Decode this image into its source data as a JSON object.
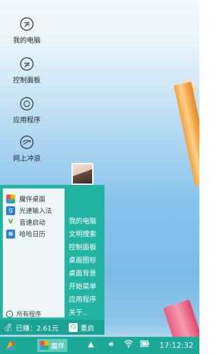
{
  "desktop": {
    "icons": [
      {
        "label": "我的电脑",
        "icon": "computer-icon"
      },
      {
        "label": "控制面板",
        "icon": "control-panel-icon"
      },
      {
        "label": "应用程序",
        "icon": "apps-icon"
      },
      {
        "label": "网上冲浪",
        "icon": "browser-icon"
      }
    ]
  },
  "start_menu": {
    "apps": [
      {
        "label": "魔伴桌面",
        "icon": "moban-desktop-icon",
        "color": "#f5b400"
      },
      {
        "label": "光速输入法",
        "icon": "keyboard-icon",
        "color": "#2a7fd4"
      },
      {
        "label": "音速启动",
        "icon": "v-launcher-icon",
        "color": "#3fae3f"
      },
      {
        "label": "哈哈日历",
        "icon": "calendar-icon",
        "color": "#2f7fd8"
      }
    ],
    "all_programs": "所有程序",
    "quick_links": [
      "我的电脑",
      "文明搜索",
      "控制面板",
      "桌面图标",
      "桌面背景",
      "开始菜单",
      "应用程序",
      "关于.."
    ],
    "earnings": "已赚：2.61元",
    "restart_label": "重启"
  },
  "taskbar": {
    "active_app": "魔伴",
    "clock": "17:12:32"
  },
  "colors": {
    "menu_bg": "#22b3a3",
    "taskbar_bg": "#1ca997",
    "menu_panel_bg": "#eef7f5"
  }
}
